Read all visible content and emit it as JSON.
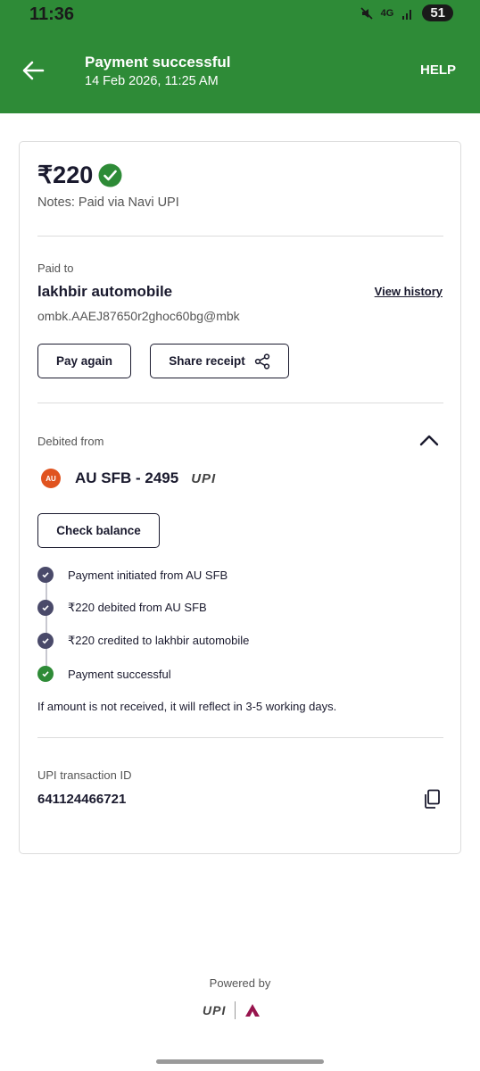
{
  "status_bar": {
    "time": "11:36",
    "network": "4G",
    "battery": "51"
  },
  "header": {
    "title": "Payment successful",
    "subtitle": "14 Feb 2026, 11:25 AM",
    "help": "HELP"
  },
  "summary": {
    "amount": "₹220",
    "notes": "Notes: Paid via Navi UPI"
  },
  "paid_to": {
    "label": "Paid to",
    "name": "lakhbir automobile",
    "view_history": "View history",
    "upi_id": "ombk.AAEJ87650r2ghoc60bg@mbk",
    "pay_again": "Pay again",
    "share_receipt": "Share receipt"
  },
  "debited_from": {
    "label": "Debited from",
    "bank_logo": "AU",
    "bank": "AU SFB - 2495",
    "upi_logo": "UPI",
    "check_balance": "Check balance",
    "timeline": [
      "Payment initiated from AU SFB",
      "₹220 debited from AU SFB",
      "₹220 credited to lakhbir automobile",
      "Payment successful"
    ],
    "note": "If amount is not received, it will reflect in 3-5 working days."
  },
  "transaction": {
    "label": "UPI transaction ID",
    "id": "641124466721"
  },
  "footer": {
    "powered_by": "Powered by",
    "upi_logo": "UPI"
  },
  "colors": {
    "header_green": "#2e8b37",
    "success_green": "#2e8b37",
    "dark": "#1a1a2e",
    "timeline_dot": "#4a4a6a"
  }
}
